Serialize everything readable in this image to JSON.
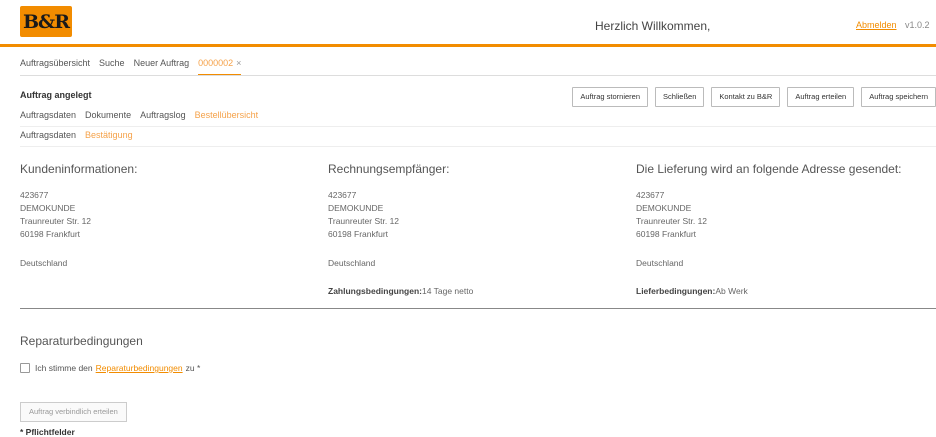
{
  "header": {
    "logo_text": "B&R",
    "welcome": "Herzlich Willkommen,",
    "logout": "Abmelden",
    "version": "v1.0.2",
    "accent": "#f28c00"
  },
  "main_tabs": [
    {
      "label": "Auftragsübersicht"
    },
    {
      "label": "Suche"
    },
    {
      "label": "Neuer Auftrag"
    },
    {
      "label": "0000002",
      "close": "×"
    }
  ],
  "order": {
    "status": "Auftrag angelegt",
    "actions": [
      "Auftrag stornieren",
      "Schließen",
      "Kontakt zu B&R",
      "Auftrag erteilen",
      "Auftrag speichern"
    ]
  },
  "sub_tabs": [
    "Auftragsdaten",
    "Dokumente",
    "Auftragslog",
    "Bestellübersicht"
  ],
  "sub_sub_tabs": [
    "Auftragsdaten",
    "Bestätigung"
  ],
  "customer": {
    "title": "Kundeninformationen:",
    "lines": [
      "423677",
      "DEMOKUNDE",
      "Traunreuter Str. 12",
      "60198 Frankfurt"
    ],
    "country": "Deutschland"
  },
  "billing": {
    "title": "Rechnungsempfänger:",
    "lines": [
      "423677",
      "DEMOKUNDE",
      "Traunreuter Str. 12",
      "60198 Frankfurt"
    ],
    "country": "Deutschland",
    "terms_label": "Zahlungsbedingungen:",
    "terms_value": "14 Tage netto"
  },
  "delivery": {
    "title": "Die Lieferung wird an folgende Adresse gesendet:",
    "lines": [
      "423677",
      "DEMOKUNDE",
      "Traunreuter Str. 12",
      "60198 Frankfurt"
    ],
    "country": "Deutschland",
    "terms_label": "Lieferbedingungen:",
    "terms_value": "Ab Werk"
  },
  "repair": {
    "title": "Reparaturbedingungen",
    "consent_prefix": "Ich stimme den",
    "consent_link": "Reparaturbedingungen",
    "consent_suffix": "zu *",
    "submit": "Auftrag verbindlich erteilen",
    "required_note": "* Pflichtfelder"
  }
}
